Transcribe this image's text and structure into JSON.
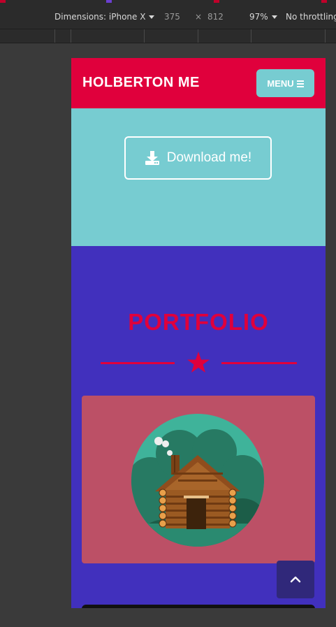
{
  "devtools": {
    "device_label": "Dimensions: iPhone X",
    "width_value": "375",
    "times_symbol": "×",
    "height_value": "812",
    "zoom_label": "97%",
    "throttle_label": "No throttling"
  },
  "site": {
    "brand": "HOLBERTON ME",
    "menu_label": "MENU",
    "download_label": "Download me!",
    "portfolio_title": "PORTFOLIO"
  },
  "colors": {
    "primary": "#e0003c",
    "teal": "#77ccd1",
    "purple": "#4130bd",
    "card": "#bc5066"
  }
}
